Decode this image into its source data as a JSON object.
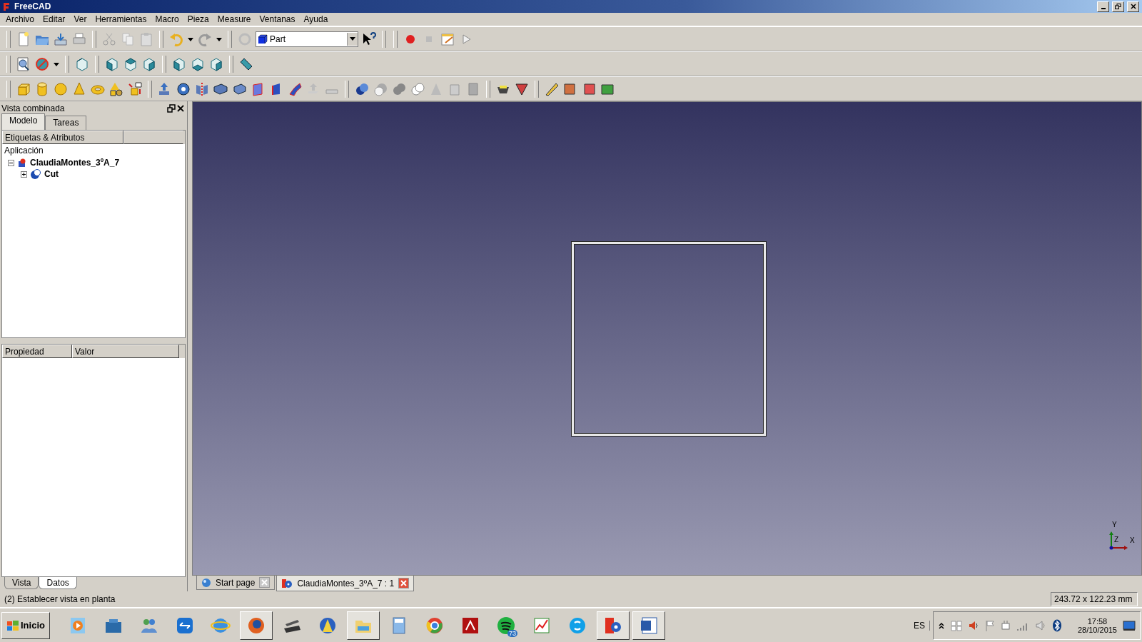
{
  "window": {
    "title": "FreeCAD"
  },
  "menu": [
    "Archivo",
    "Editar",
    "Ver",
    "Herramientas",
    "Macro",
    "Pieza",
    "Measure",
    "Ventanas",
    "Ayuda"
  ],
  "workbench": {
    "value": "Part"
  },
  "panel": {
    "title": "Vista combinada",
    "tabs": [
      {
        "label": "Modelo",
        "selected": true
      },
      {
        "label": "Tareas",
        "selected": false
      }
    ],
    "tree_column": "Etiquetas & Atributos",
    "root": "Aplicación",
    "items": [
      {
        "label": "ClaudiaMontes_3ºA_7",
        "expanded": true,
        "children": [
          {
            "label": "Cut",
            "expanded": false
          }
        ]
      }
    ],
    "property_columns": [
      "Propiedad",
      "Valor"
    ],
    "bottom_tabs": [
      {
        "label": "Vista",
        "selected": false
      },
      {
        "label": "Datos",
        "selected": true
      }
    ]
  },
  "axes": {
    "y": "Y",
    "z": "Z",
    "x": "X"
  },
  "document_tabs": [
    {
      "label": "Start page",
      "selected": false
    },
    {
      "label": "ClaudiaMontes_3ºA_7 : 1",
      "selected": true
    }
  ],
  "status_bar": {
    "message": "(2) Establecer vista en planta",
    "dimensions": "243.72 x 122.23 mm"
  },
  "taskbar": {
    "start": "Inicio",
    "apps": [
      {
        "selected": false
      },
      {
        "selected": false
      },
      {
        "selected": false
      },
      {
        "selected": false
      },
      {
        "selected": false
      },
      {
        "selected": true
      },
      {
        "selected": false
      },
      {
        "selected": false
      },
      {
        "selected": true
      },
      {
        "selected": false
      },
      {
        "selected": false
      },
      {
        "selected": false
      },
      {
        "selected": false,
        "badge": "73"
      },
      {
        "selected": false
      },
      {
        "selected": false
      },
      {
        "selected": true
      },
      {
        "selected": true
      }
    ],
    "language": "ES",
    "time": "17:58",
    "date": "28/10/2015"
  }
}
